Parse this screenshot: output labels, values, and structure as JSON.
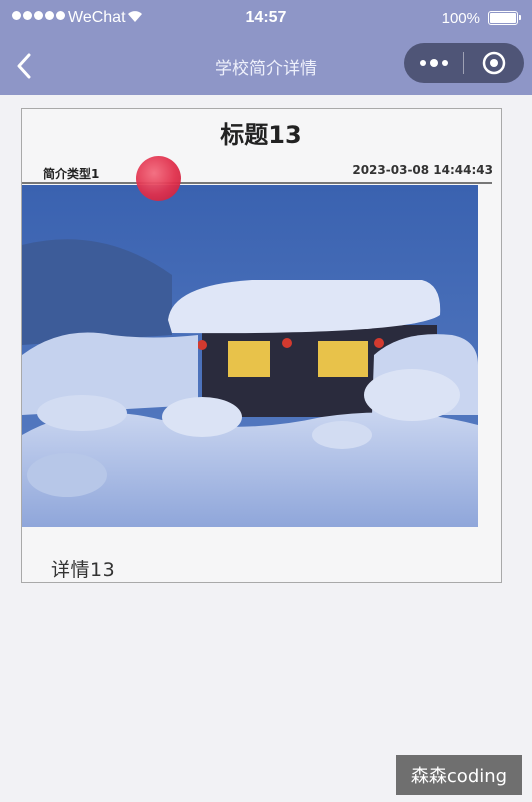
{
  "status_bar": {
    "carrier": "WeChat",
    "time": "14:57",
    "battery": "100%"
  },
  "nav": {
    "title": "学校简介详情",
    "back_icon": "chevron-left-icon",
    "more_icon": "more-dots-icon",
    "close_icon": "target-circle-icon"
  },
  "article": {
    "title": "标题13",
    "type": "简介类型1",
    "datetime": "2023-03-08 14:44:43",
    "detail": "详情13"
  },
  "watermark": "森森coding",
  "colors": {
    "header": "#8e96c7",
    "capsule": "#4f5577",
    "touch_indicator": "#e0304c"
  }
}
